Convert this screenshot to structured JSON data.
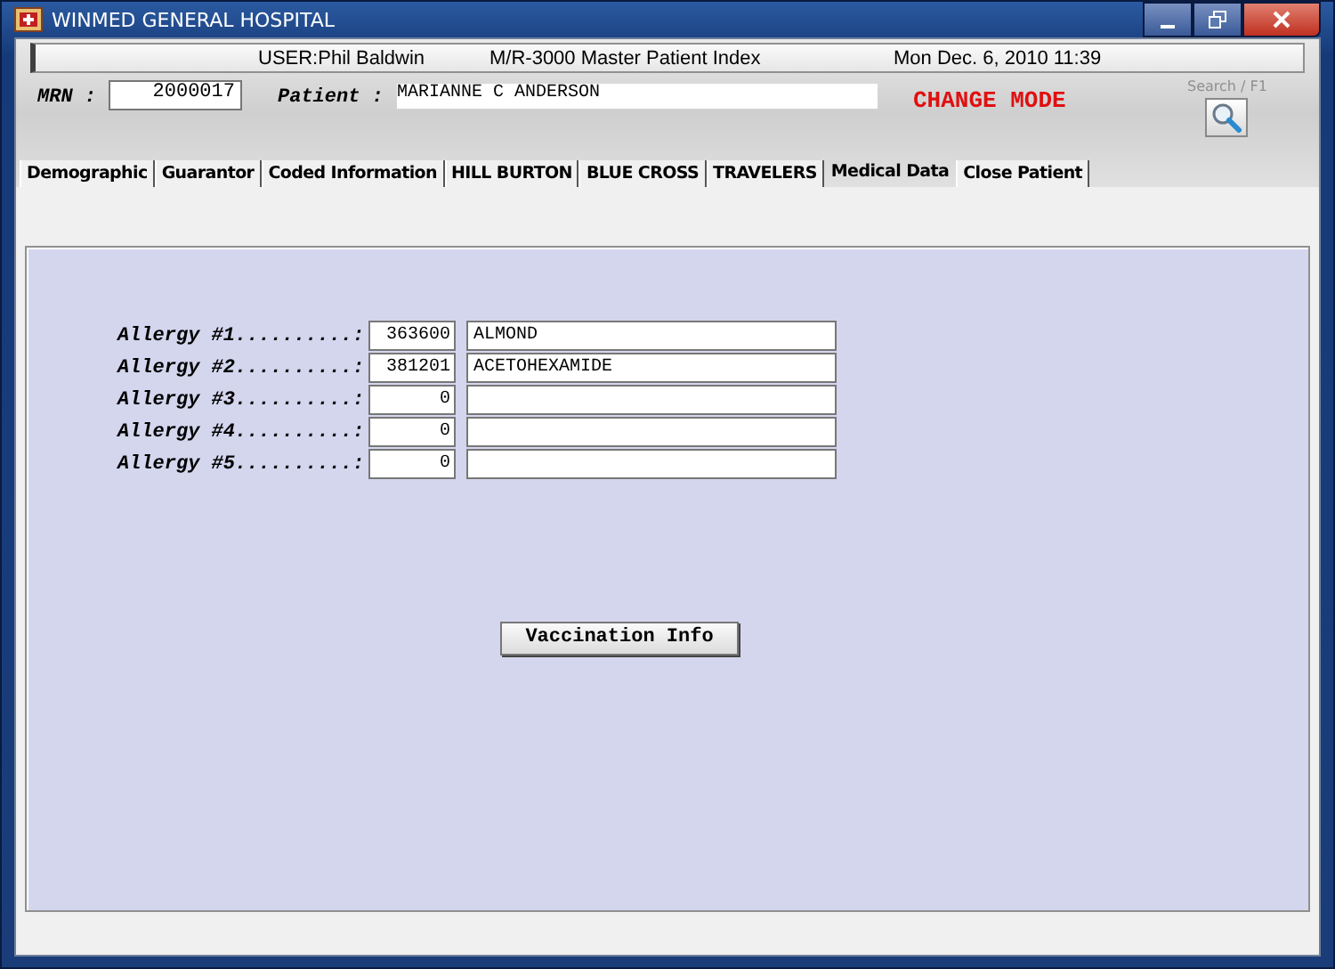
{
  "window": {
    "title": "WINMED GENERAL HOSPITAL"
  },
  "header": {
    "user": "USER:Phil Baldwin",
    "system": "M/R-3000   Master Patient Index",
    "datetime": "Mon Dec.  6, 2010 11:39"
  },
  "patient_bar": {
    "mrn_label": "MRN :",
    "mrn": "2000017",
    "patient_label": "Patient :",
    "patient": "MARIANNE C ANDERSON",
    "mode": "CHANGE MODE",
    "search_label": "Search / F1"
  },
  "tabs": [
    {
      "label": "Demographic",
      "selected": false
    },
    {
      "label": "Guarantor",
      "selected": false
    },
    {
      "label": "Coded Information",
      "selected": false
    },
    {
      "label": "HILL BURTON",
      "selected": false
    },
    {
      "label": "BLUE CROSS",
      "selected": false
    },
    {
      "label": "TRAVELERS",
      "selected": false
    },
    {
      "label": "Medical Data",
      "selected": true
    },
    {
      "label": "Close Patient",
      "selected": false
    }
  ],
  "allergies": [
    {
      "label": "Allergy #1..........:",
      "code": "363600",
      "name": "ALMOND"
    },
    {
      "label": "Allergy #2..........:",
      "code": "381201",
      "name": "ACETOHEXAMIDE"
    },
    {
      "label": "Allergy #3..........:",
      "code": "0"
    },
    {
      "label": "Allergy #4..........:",
      "code": "0"
    },
    {
      "label": "Allergy #5..........:",
      "code": "0"
    }
  ],
  "buttons": [
    "Vaccination Info"
  ]
}
